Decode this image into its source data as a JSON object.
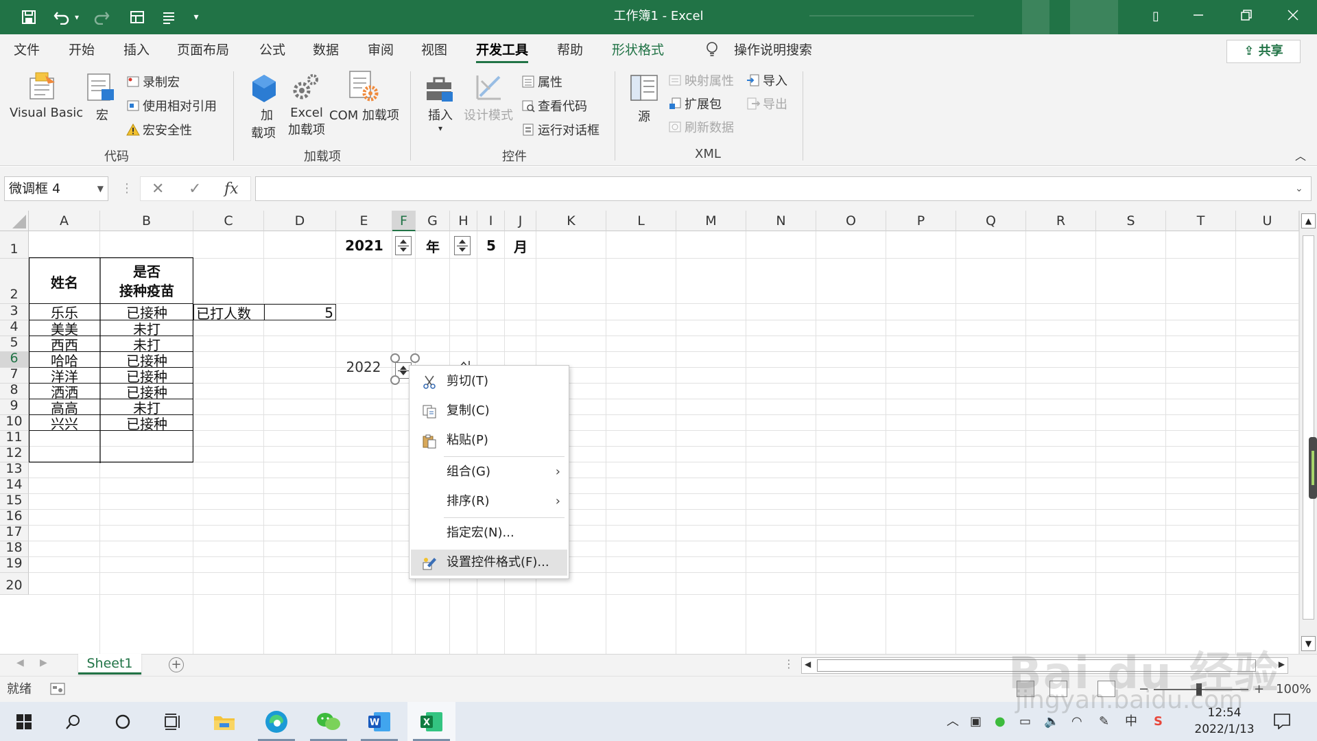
{
  "window": {
    "title": "工作簿1  -  Excel"
  },
  "tabs": [
    "文件",
    "开始",
    "插入",
    "页面布局",
    "公式",
    "数据",
    "审阅",
    "视图",
    "开发工具",
    "帮助",
    "形状格式"
  ],
  "tell_me": "操作说明搜索",
  "share": "共享",
  "ribbon": {
    "code": {
      "visual_basic": "Visual Basic",
      "macro": "宏",
      "record": "录制宏",
      "relative": "使用相对引用",
      "security": "宏安全性",
      "label": "代码"
    },
    "addins": {
      "addin_1": "加",
      "addin_2": "载项",
      "excel_1": "Excel",
      "excel_2": "加载项",
      "com": "COM 加载项",
      "label": "加载项"
    },
    "controls": {
      "insert": "插入",
      "design": "设计模式",
      "props": "属性",
      "view_code": "查看代码",
      "run_dialog": "运行对话框",
      "label": "控件"
    },
    "xml": {
      "source": "源",
      "map_props": "映射属性",
      "expansion": "扩展包",
      "refresh": "刷新数据",
      "import": "导入",
      "export": "导出",
      "label": "XML"
    }
  },
  "namebox": "微调框 4",
  "fx": "fx",
  "columns": [
    "A",
    "B",
    "C",
    "D",
    "E",
    "F",
    "G",
    "H",
    "I",
    "J",
    "K",
    "L",
    "M",
    "N",
    "O",
    "P",
    "Q",
    "R",
    "S",
    "T",
    "U"
  ],
  "rows": [
    "1",
    "2",
    "3",
    "4",
    "5",
    "6",
    "7",
    "8",
    "9",
    "10",
    "11",
    "12",
    "13",
    "14",
    "15",
    "16",
    "17",
    "18",
    "19",
    "20"
  ],
  "cells": {
    "e1": "2021",
    "g1": "年",
    "i1": "5",
    "j1": "月",
    "a2": "姓名",
    "b2_line1": "是否",
    "b2_line2": "接种疫苗",
    "c3": "已打人数",
    "d3": "5",
    "e6": "2022",
    "names": [
      "乐乐",
      "美美",
      "西西",
      "哈哈",
      "洋洋",
      "洒洒",
      "高高",
      "兴兴"
    ],
    "status": [
      "已接种",
      "未打",
      "未打",
      "已接种",
      "已接种",
      "已接种",
      "未打",
      "已接种"
    ]
  },
  "context_menu": [
    {
      "label": "剪切(T)",
      "icon": "scissors-icon"
    },
    {
      "label": "复制(C)",
      "icon": "copy-icon"
    },
    {
      "label": "粘贴(P)",
      "icon": "paste-icon"
    },
    {
      "label": "组合(G)",
      "submenu": true
    },
    {
      "label": "排序(R)",
      "submenu": true
    },
    {
      "label": "指定宏(N)..."
    },
    {
      "label": "设置控件格式(F)...",
      "icon": "format-control-icon",
      "highlighted": true
    }
  ],
  "sheet_tab": "Sheet1",
  "status": {
    "ready": "就绪",
    "zoom": "100%"
  },
  "clock": {
    "time": "12:54",
    "date": "2022/1/13"
  },
  "ime": "中",
  "watermark": {
    "brand": "Bai du 经验",
    "url": "jingyan.baidu.com"
  },
  "colors": {
    "excel_green": "#217346",
    "taskbar": "#e4eaf2"
  }
}
